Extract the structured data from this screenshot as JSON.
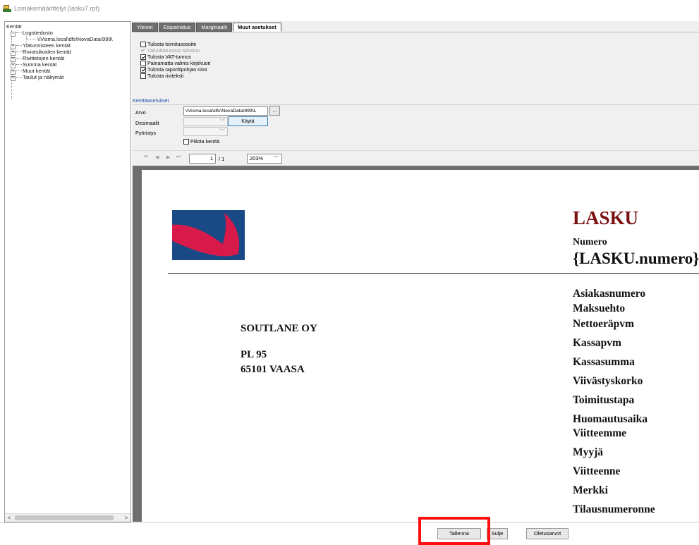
{
  "window": {
    "title": "Lomakemäärittelyt (lasku7.rpt)"
  },
  "tree": {
    "root": "Kentät",
    "items": [
      {
        "label": "Logotiedosto",
        "expander": "-"
      },
      {
        "label": "\\\\Visma.local\\dfs\\NovaData\\999\\",
        "expander": ""
      },
      {
        "label": "Ylätunnisteen kentät",
        "expander": "+"
      },
      {
        "label": "Riviotsikoiden kentät",
        "expander": "+"
      },
      {
        "label": "Rivitietojen kentät",
        "expander": "+"
      },
      {
        "label": "Summa kentät",
        "expander": "+"
      },
      {
        "label": "Muut kentät",
        "expander": "+"
      },
      {
        "label": "Taulut ja näkymät",
        "expander": "+"
      }
    ],
    "scroll_left": "<",
    "scroll_right": ">"
  },
  "tabs": [
    {
      "label": "Yleiset",
      "active": false
    },
    {
      "label": "Esipainatus",
      "active": false
    },
    {
      "label": "Marginaalit",
      "active": false
    },
    {
      "label": "Muut asetukset",
      "active": true
    }
  ],
  "options": [
    {
      "label": "Tulosta toimitusosoite",
      "checked": false,
      "disabled": false
    },
    {
      "label": "Valuuttatunnus tulostus",
      "checked": true,
      "disabled": true
    },
    {
      "label": "Tulosta VAT-tunnus",
      "checked": true,
      "disabled": false
    },
    {
      "label": "Painamatta valmis kirjekuori",
      "checked": false,
      "disabled": false
    },
    {
      "label": "Tulosta raporttipohjan nimi",
      "checked": true,
      "disabled": false
    },
    {
      "label": "Tulosta riviteksti",
      "checked": false,
      "disabled": false
    }
  ],
  "field_settings": {
    "legend": "Kenttäasetukset",
    "arvo_label": "Arvo",
    "arvo_value": "\\\\Visma.local\\dfs\\NovaData\\999\\L",
    "browse_label": "...",
    "desimaalit_label": "Desimaalit",
    "kayta_label": "Käytä",
    "pyoristys_label": "Pyöristys",
    "piilota_label": "Piilota kenttä"
  },
  "preview_toolbar": {
    "first": "⏮",
    "prev": "◀",
    "next": "▶",
    "last": "⏭",
    "page": "1",
    "total": "/ 1",
    "zoom": "203%"
  },
  "document": {
    "title": "LASKU",
    "numero_label": "Numero",
    "numero_value": "{LASKU.numero}",
    "company": "SOUTLANE OY",
    "address1": "PL 95",
    "address2": "65101  VAASA",
    "fields": [
      "Asiakasnumero",
      "Maksuehto",
      "Nettoeräpvm",
      "Kassapvm",
      "Kassasumma",
      "Viivästyskorko",
      "Toimitustapa",
      "Huomautusaika",
      "Viitteemme",
      "Myyjä",
      "Viitteenne",
      "Merkki",
      "Tilausnumeronne"
    ]
  },
  "buttons": {
    "save": "Tallenna",
    "close": "Sulje",
    "defaults": "Oletusarvot"
  },
  "colors": {
    "title_red": "#7a1010",
    "logo_blue": "#1a4a85",
    "logo_red": "#d81a4a",
    "highlight": "#ff1010",
    "legend_blue": "#1e4fa8"
  }
}
